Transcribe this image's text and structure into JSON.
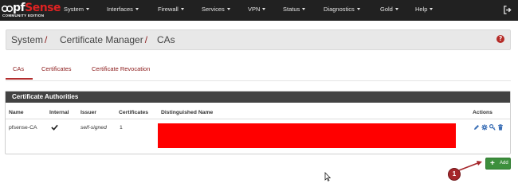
{
  "navbar": {
    "logo": {
      "word_pf": "pf",
      "word_sense": "Sense",
      "subtitle": "COMMUNITY EDITION"
    },
    "items": [
      {
        "label": "System"
      },
      {
        "label": "Interfaces"
      },
      {
        "label": "Firewall"
      },
      {
        "label": "Services"
      },
      {
        "label": "VPN"
      },
      {
        "label": "Status"
      },
      {
        "label": "Diagnostics"
      },
      {
        "label": "Gold"
      },
      {
        "label": "Help"
      }
    ],
    "logout_icon": "sign-out-icon"
  },
  "breadcrumb": {
    "items": [
      {
        "label": "System"
      },
      {
        "label": "Certificate Manager"
      },
      {
        "label": "CAs"
      }
    ],
    "separator": "/",
    "help_icon_glyph": "?"
  },
  "tabs": [
    {
      "label": "CAs",
      "active": true
    },
    {
      "label": "Certificates",
      "active": false
    },
    {
      "label": "Certificate Revocation",
      "active": false
    }
  ],
  "panel": {
    "title": "Certificate Authorities",
    "columns": [
      "Name",
      "Internal",
      "Issuer",
      "Certificates",
      "Distinguished Name",
      "Actions"
    ],
    "rows": [
      {
        "name": "pfsense-CA",
        "internal": "check-icon",
        "issuer": "self-signed",
        "certificates": "1",
        "distinguished_name": "",
        "actions": [
          "edit-icon",
          "export-icon",
          "key-icon",
          "delete-icon"
        ]
      }
    ]
  },
  "add_button": {
    "label": "Add",
    "icon": "plus-icon"
  },
  "annotation": {
    "number": "1"
  },
  "colors": {
    "navbar_bg": "#212121",
    "accent_link": "#8b1a1a",
    "panel_header": "#424242",
    "add_button": "#3d8f3d",
    "redaction": "#ff0000",
    "badge": "#a5262a"
  }
}
